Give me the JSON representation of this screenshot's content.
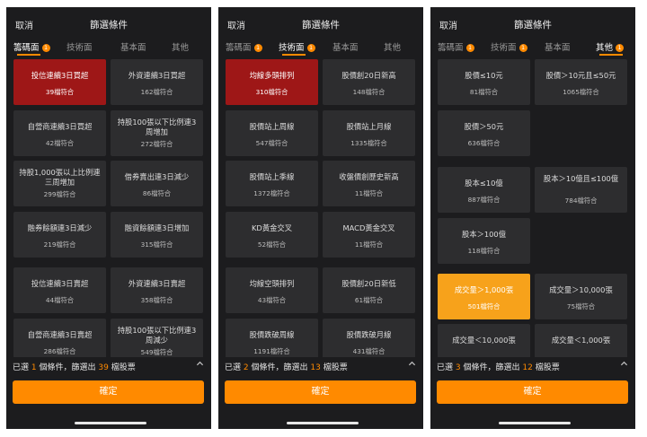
{
  "colors": {
    "accent": "#ff8a00",
    "selected_red": "#9e1717",
    "selected_orange": "#f7a21b",
    "card": "#2d2d2f",
    "panel": "#1c1c1e"
  },
  "common": {
    "cancel": "取消",
    "title": "篩選條件",
    "confirm": "確定",
    "chevron": "chevron-up-icon"
  },
  "panels": [
    {
      "tabs": [
        {
          "label": "籌碼面",
          "badge": "1",
          "active": true
        },
        {
          "label": "技術面",
          "badge": "",
          "active": false
        },
        {
          "label": "基本面",
          "badge": "",
          "active": false
        },
        {
          "label": "其他",
          "badge": "",
          "active": false
        }
      ],
      "cards": [
        {
          "name": "投信連續3日買超",
          "count": "39檔符合",
          "sel": "red"
        },
        {
          "name": "外資連續3日買超",
          "count": "162檔符合",
          "sel": ""
        },
        {
          "name": "自營商連續3日買超",
          "count": "42檔符合",
          "sel": ""
        },
        {
          "name": "持股100張以下比例連3周增加",
          "count": "272檔符合",
          "sel": ""
        },
        {
          "name": "持股1,000張以上比例連三周增加",
          "count": "299檔符合",
          "sel": ""
        },
        {
          "name": "借券賣出連3日減少",
          "count": "86檔符合",
          "sel": ""
        },
        {
          "name": "融券餘額連3日減少",
          "count": "219檔符合",
          "sel": ""
        },
        {
          "name": "融資餘額連3日增加",
          "count": "315檔符合",
          "sel": ""
        },
        {
          "name": "投信連續3日賣超",
          "count": "44檔符合",
          "sel": ""
        },
        {
          "name": "外資連續3日賣超",
          "count": "358檔符合",
          "sel": ""
        },
        {
          "name": "自營商連續3日賣超",
          "count": "286檔符合",
          "sel": ""
        },
        {
          "name": "持股100張以下比例連3周減少",
          "count": "549檔符合",
          "sel": ""
        }
      ],
      "summary": {
        "prefix": "已選",
        "conditions": "1",
        "middle": "個條件，篩選出",
        "stocks": "39",
        "suffix": "檔股票"
      }
    },
    {
      "tabs": [
        {
          "label": "籌碼面",
          "badge": "1",
          "active": false
        },
        {
          "label": "技術面",
          "badge": "1",
          "active": true
        },
        {
          "label": "基本面",
          "badge": "",
          "active": false
        },
        {
          "label": "其他",
          "badge": "",
          "active": false
        }
      ],
      "cards": [
        {
          "name": "均線多頭排列",
          "count": "310檔符合",
          "sel": "red"
        },
        {
          "name": "股價創20日新高",
          "count": "148檔符合",
          "sel": ""
        },
        {
          "name": "股價站上周線",
          "count": "547檔符合",
          "sel": ""
        },
        {
          "name": "股價站上月線",
          "count": "1335檔符合",
          "sel": ""
        },
        {
          "name": "股價站上季線",
          "count": "1372檔符合",
          "sel": ""
        },
        {
          "name": "收盤價創歷史新高",
          "count": "11檔符合",
          "sel": ""
        },
        {
          "name": "KD黃金交叉",
          "count": "52檔符合",
          "sel": ""
        },
        {
          "name": "MACD黃金交叉",
          "count": "11檔符合",
          "sel": ""
        },
        {
          "name": "均線空頭排列",
          "count": "43檔符合",
          "sel": ""
        },
        {
          "name": "股價創20日新低",
          "count": "61檔符合",
          "sel": ""
        },
        {
          "name": "股價跌破周線",
          "count": "1191檔符合",
          "sel": ""
        },
        {
          "name": "股價跌破月線",
          "count": "431檔符合",
          "sel": ""
        }
      ],
      "summary": {
        "prefix": "已選",
        "conditions": "2",
        "middle": "個條件，篩選出",
        "stocks": "13",
        "suffix": "檔股票"
      }
    },
    {
      "tabs": [
        {
          "label": "籌碼面",
          "badge": "1",
          "active": false
        },
        {
          "label": "技術面",
          "badge": "1",
          "active": false
        },
        {
          "label": "基本面",
          "badge": "",
          "active": false
        },
        {
          "label": "其他",
          "badge": "1",
          "active": true
        }
      ],
      "cards": [
        {
          "name": "股價≤10元",
          "count": "81檔符合",
          "sel": ""
        },
        {
          "name": "股價＞10元且≤50元",
          "count": "1065檔符合",
          "sel": ""
        },
        {
          "name": "股價＞50元",
          "count": "636檔符合",
          "sel": ""
        },
        {
          "name": "股本≤10億",
          "count": "887檔符合",
          "sel": ""
        },
        {
          "name": "股本＞10億且≤100億",
          "count": "784檔符合",
          "sel": ""
        },
        {
          "name": "股本＞100億",
          "count": "118檔符合",
          "sel": ""
        },
        {
          "name": "成交量＞1,000張",
          "count": "501檔符合",
          "sel": "orange"
        },
        {
          "name": "成交量＞10,000張",
          "count": "75檔符合",
          "sel": ""
        },
        {
          "name": "成交量＜10,000張",
          "count": "",
          "sel": ""
        },
        {
          "name": "成交量＜1,000張",
          "count": "",
          "sel": ""
        }
      ],
      "summary": {
        "prefix": "已選",
        "conditions": "3",
        "middle": "個條件，篩選出",
        "stocks": "12",
        "suffix": "檔股票"
      }
    }
  ]
}
